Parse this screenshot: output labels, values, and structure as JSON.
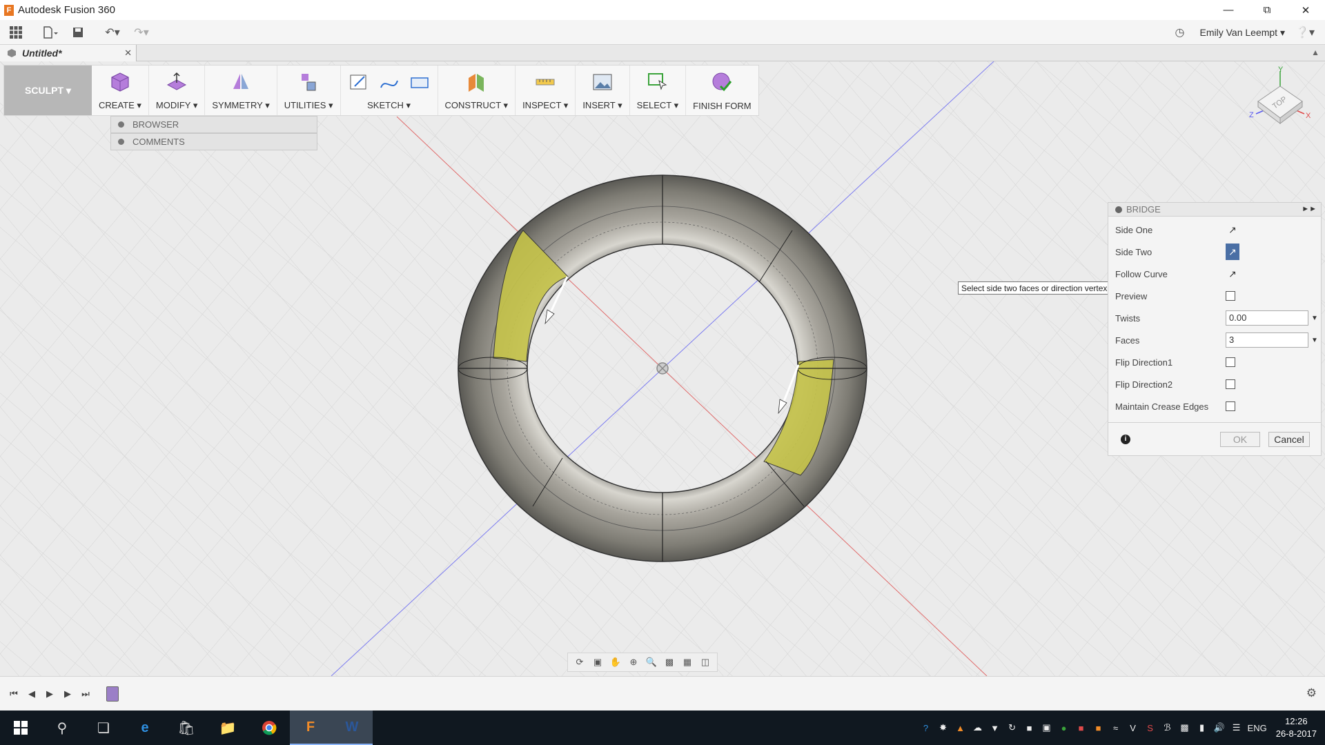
{
  "window": {
    "title": "Autodesk Fusion 360",
    "logo_letter": "F"
  },
  "user": {
    "name": "Emily Van Leempt"
  },
  "document": {
    "tab_label": "Untitled*"
  },
  "toolbar": {
    "workspace": "SCULPT",
    "groups": [
      {
        "label": "CREATE"
      },
      {
        "label": "MODIFY"
      },
      {
        "label": "SYMMETRY"
      },
      {
        "label": "UTILITIES"
      },
      {
        "label": "SKETCH"
      },
      {
        "label": "CONSTRUCT"
      },
      {
        "label": "INSPECT"
      },
      {
        "label": "INSERT"
      },
      {
        "label": "SELECT"
      },
      {
        "label": "FINISH FORM"
      }
    ]
  },
  "side_panel": {
    "browser": "BROWSER",
    "comments": "COMMENTS"
  },
  "viewcube": {
    "face_label": "TOP",
    "axis_x": "X",
    "axis_y": "Y",
    "axis_z": "Z"
  },
  "bridge": {
    "title": "BRIDGE",
    "side_one": "Side One",
    "side_two": "Side Two",
    "follow_curve": "Follow Curve",
    "preview": "Preview",
    "twists_label": "Twists",
    "twists_value": "0.00",
    "faces_label": "Faces",
    "faces_value": "3",
    "flip1": "Flip Direction1",
    "flip2": "Flip Direction2",
    "crease": "Maintain Crease Edges",
    "ok": "OK",
    "cancel": "Cancel"
  },
  "tooltip": "Select side two faces or direction vertex",
  "taskbar": {
    "lang": "ENG",
    "time": "12:26",
    "date": "26-8-2017"
  },
  "colors": {
    "selected_face": "#bdbc3f",
    "torus_body": "#8a8880",
    "viewport_bg": "#ebebeb",
    "taskbar": "#101820"
  }
}
